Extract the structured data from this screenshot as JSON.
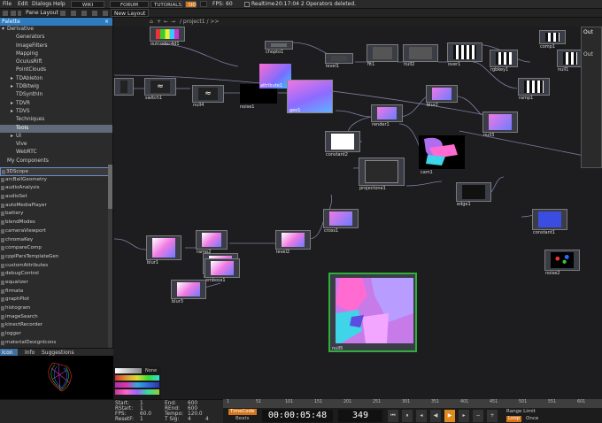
{
  "menu": {
    "items": [
      "File",
      "Edit",
      "Dialogs",
      "Help"
    ],
    "wiki": "WIKI",
    "forum": "FORUM",
    "tutorials": "TUTORIALS",
    "oo": "OO",
    "fps_label": "FPS:",
    "fps_value": "60",
    "realtime": "Realtime",
    "status": "20:17:04 2 Operators deleted."
  },
  "toolbar2": {
    "pane_layout": "Pane Layout",
    "new_layout": "New Layout",
    "path": "/ project1 / >>"
  },
  "palette": {
    "title": "Palette",
    "tree": [
      {
        "label": "Derivative",
        "indent": 0,
        "arrow": "▾"
      },
      {
        "label": "Generators",
        "indent": 1,
        "arrow": ""
      },
      {
        "label": "ImageFilters",
        "indent": 1,
        "arrow": ""
      },
      {
        "label": "Mapping",
        "indent": 1,
        "arrow": ""
      },
      {
        "label": "OculusRift",
        "indent": 1,
        "arrow": ""
      },
      {
        "label": "PointClouds",
        "indent": 1,
        "arrow": ""
      },
      {
        "label": "TDAbleton",
        "indent": 1,
        "arrow": "▸"
      },
      {
        "label": "TDBitwig",
        "indent": 1,
        "arrow": "▸"
      },
      {
        "label": "TDSynthIn",
        "indent": 1,
        "arrow": ""
      },
      {
        "label": "TDVR",
        "indent": 1,
        "arrow": "▸"
      },
      {
        "label": "TDVS",
        "indent": 1,
        "arrow": "▸"
      },
      {
        "label": "Techniques",
        "indent": 1,
        "arrow": ""
      },
      {
        "label": "Tools",
        "indent": 1,
        "arrow": "",
        "selected": true
      },
      {
        "label": "UI",
        "indent": 1,
        "arrow": "▸"
      },
      {
        "label": "Vive",
        "indent": 1,
        "arrow": ""
      },
      {
        "label": "WebRTC",
        "indent": 1,
        "arrow": ""
      },
      {
        "label": "My Components",
        "indent": 0,
        "arrow": ""
      }
    ],
    "components": [
      "3DScope",
      "arcBallGeometry",
      "audioAnalysis",
      "audioSet",
      "autoMediaPlayer",
      "battery",
      "blendModes",
      "cameraViewport",
      "chromaKey",
      "compareComp",
      "cpplParsTemplateGen",
      "customAttributes",
      "debugControl",
      "equalizer",
      "firmata",
      "graphPlot",
      "histogram",
      "imageSearch",
      "kinectRecorder",
      "logger",
      "materialDesignIcons",
      "movieBlender",
      "movieEngine"
    ],
    "tabs": [
      "Icon",
      "Info",
      "Suggestions"
    ]
  },
  "nodes": {
    "n1": "outcodec4d1",
    "n2": "chopto1",
    "n3": "level1",
    "n4": "fit1",
    "n5": "null2",
    "n6": "over1",
    "n7": "rgbkey1",
    "n8": "comp1",
    "n9": "out",
    "n10": "null1",
    "n11": "switch1",
    "n12": "null4",
    "n13": "noise1",
    "n14": "attribute1",
    "n15": "geo1",
    "n16": "render1",
    "n17": "blur2",
    "n18": "null3",
    "n19": "ramp1",
    "n20": "constant2",
    "n21": "cam1",
    "n22": "projectone1",
    "n23": "edge1",
    "n24": "cross1",
    "n25": "constant1",
    "n26": "blur1",
    "n27": "ramp2",
    "n28": "level2",
    "n29": "cross2",
    "n30": "emboss1",
    "n31": "blur3",
    "n32": "noise2",
    "n33": "null5"
  },
  "network": {
    "out_label": "Out",
    "out_sub": "Out"
  },
  "bottom": {
    "start_label": "Start:",
    "start": "1",
    "end_label": "End:",
    "end": "600",
    "rstart_label": "RStart:",
    "rstart": "1",
    "rend_label": "REnd:",
    "rend": "600",
    "fps_label": "FPS:",
    "fps": "60.0",
    "tempo_label": "Tempo:",
    "tempo": "120.0",
    "resetf_label": "ResetF:",
    "resetf": "1",
    "tsig_label": "T Sig:",
    "tsig1": "4",
    "tsig2": "4",
    "timecode_label": "TimeCode",
    "beats_label": "Beats",
    "timecode": "00:00:05:48",
    "frame": "349",
    "range_limit": "Range Limit",
    "loop": "Loop",
    "once": "Once",
    "none_label": "None"
  },
  "timeline_ticks": [
    "1",
    "51",
    "101",
    "151",
    "201",
    "251",
    "301",
    "351",
    "401",
    "451",
    "501",
    "551",
    "601"
  ],
  "colors": {
    "accent": "#2f7bbf",
    "selected_node": "#2fae3a",
    "timecode_bg": "#1a1a1a",
    "play": "#e08a1e"
  }
}
